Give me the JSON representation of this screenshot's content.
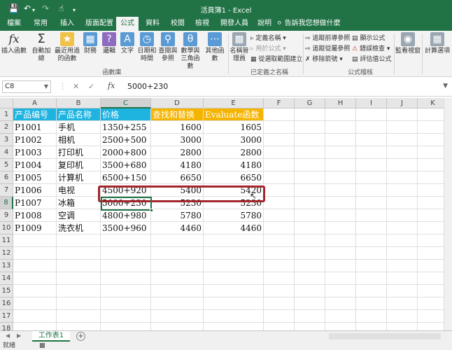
{
  "title_bar": {
    "save_icon": "floppy-disk-icon",
    "undo_icon": "undo-icon",
    "redo_icon": "redo-icon",
    "touch_icon": "touch-mode-icon",
    "customize_icon": "customize-quick-access-icon",
    "window_title": "活頁簿1 - Excel"
  },
  "tabs": [
    "檔案",
    "常用",
    "插入",
    "版面配置",
    "公式",
    "資料",
    "校閱",
    "檢視",
    "開發人員",
    "說明"
  ],
  "active_tab": "公式",
  "tell_me": "告訴我您想做什麼",
  "ribbon": {
    "function_library": {
      "insert_function": "插入函數",
      "autosum": "自動加總",
      "recent": "最近用過的函數",
      "financial": "財務",
      "logical": "邏輯",
      "text": "文字",
      "date_time": "日期和時間",
      "lookup": "查閱與參照",
      "math": "數學與三角函數",
      "more": "其他函數",
      "group_label": "函數庫"
    },
    "defined_names": {
      "name_manager": "名稱管理員",
      "define_name": "定義名稱",
      "use_in_formula": "用於公式",
      "create_from_selection": "從選取範圍建立",
      "group_label": "已定義之名稱"
    },
    "formula_auditing": {
      "trace_precedents": "追蹤前導參照",
      "trace_dependents": "追蹤從屬參照",
      "remove_arrows": "移除箭號",
      "show_formulas": "顯示公式",
      "error_checking": "錯誤檢查",
      "evaluate_formula": "評估值公式",
      "group_label": "公式稽核"
    },
    "watch_window": "監看視窗",
    "calc_options": "計算選項"
  },
  "formula_bar": {
    "name_box": "C8",
    "cancel_icon": "cancel-x-icon",
    "enter_icon": "check-icon",
    "fx_label": "fx",
    "formula": "5000+230"
  },
  "columns": [
    "A",
    "B",
    "C",
    "D",
    "E",
    "F",
    "G",
    "H",
    "I",
    "J",
    "K"
  ],
  "rows": [
    "1",
    "2",
    "3",
    "4",
    "5",
    "6",
    "7",
    "8",
    "9",
    "10",
    "11",
    "12",
    "13",
    "14",
    "15",
    "16",
    "17",
    "18"
  ],
  "table": {
    "headers": [
      "产品编号",
      "产品名称",
      "价格",
      "查找和替换",
      "Evaluate函数"
    ],
    "data": [
      [
        "P1001",
        "手机",
        "1350+255",
        "1600",
        "1605"
      ],
      [
        "P1002",
        "相机",
        "2500+500",
        "3000",
        "3000"
      ],
      [
        "P1003",
        "打印机",
        "2000+800",
        "2800",
        "2800"
      ],
      [
        "P1004",
        "复印机",
        "3500+680",
        "4180",
        "4180"
      ],
      [
        "P1005",
        "计算机",
        "6500+150",
        "6650",
        "6650"
      ],
      [
        "P1006",
        "电视",
        "4500+920",
        "5400",
        "5420"
      ],
      [
        "P1007",
        "冰箱",
        "5000+230",
        "5230",
        "5230"
      ],
      [
        "P1008",
        "空调",
        "4800+980",
        "5780",
        "5780"
      ],
      [
        "P1009",
        "洗衣机",
        "3500+960",
        "4460",
        "4460"
      ]
    ]
  },
  "selected_cell": "C8",
  "colors": {
    "excel_green": "#217346",
    "header_blue": "#1fb3e0",
    "header_orange": "#f5b400",
    "highlight_red": "#a4262c"
  },
  "sheet_tab": "工作表1",
  "status": "就緒"
}
